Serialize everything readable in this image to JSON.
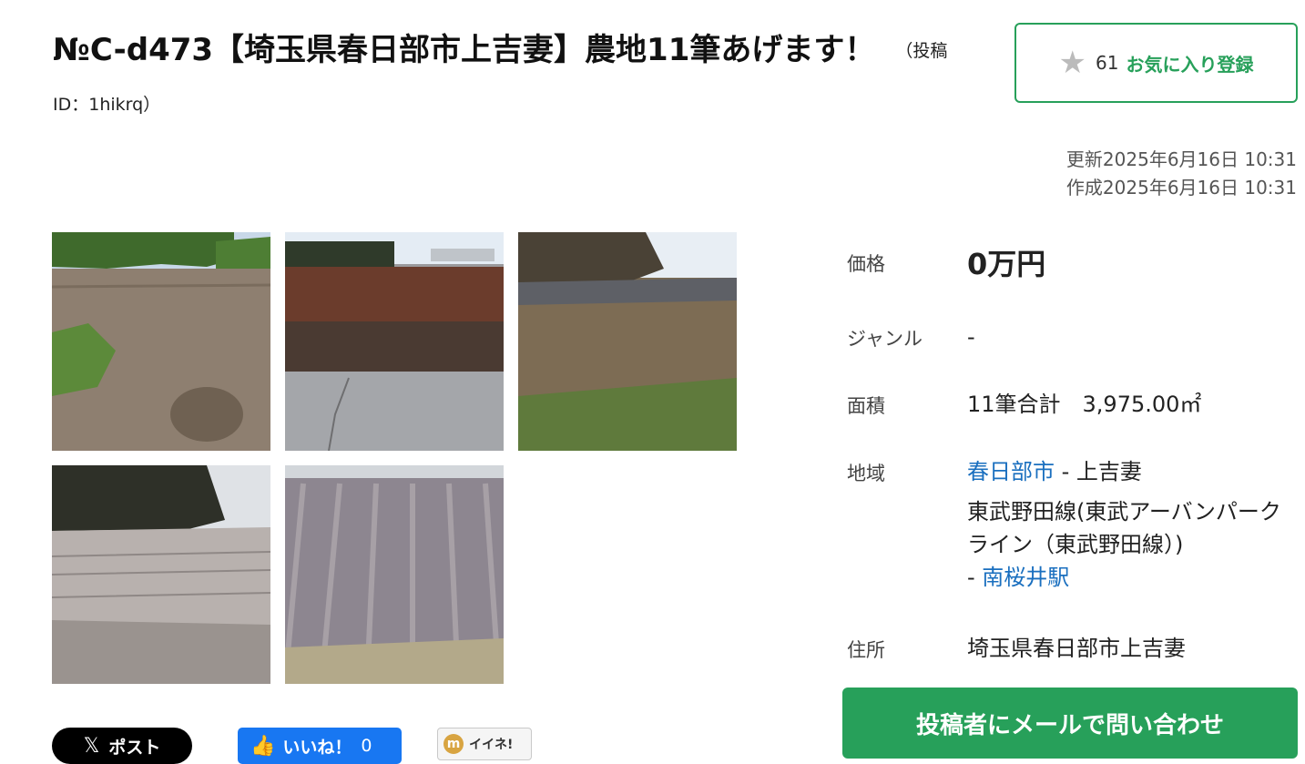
{
  "listing": {
    "title": "№C-d473【埼玉県春日部市上吉妻】農地11筆あげます！",
    "post_id": "（投稿ID：1hikrq）"
  },
  "favorite": {
    "count": "61",
    "label": "お気に入り登録",
    "icon": "star-icon"
  },
  "dates": {
    "updated": "更新2025年6月16日 10:31",
    "created": "作成2025年6月16日 10:31"
  },
  "photos": [
    "farmland-photo-1",
    "farmland-photo-2",
    "farmland-photo-3",
    "farmland-photo-4",
    "farmland-photo-5"
  ],
  "info": {
    "price_label": "価格",
    "price_value": "0万円",
    "genre_label": "ジャンル",
    "genre_value": "-",
    "area_label": "面積",
    "area_value": "11筆合計　3,975.00㎡",
    "region_label": "地域",
    "region_city": "春日部市",
    "region_sep": " - ",
    "region_town": "上吉妻",
    "line_text": "東武野田線(東武アーバンパークライン（東武野田線）)",
    "station_sep": " - ",
    "station": "南桜井駅",
    "address_label": "住所",
    "address_value": "埼玉県春日部市上吉妻"
  },
  "contact": {
    "label": "投稿者にメールで問い合わせ"
  },
  "share": {
    "x_logo": "𝕏",
    "x_label": "ポスト",
    "fb_icon": "👍",
    "fb_label": "いいね！",
    "fb_count": "0",
    "mixi_logo": "m",
    "mixi_label": "イイネ!"
  }
}
